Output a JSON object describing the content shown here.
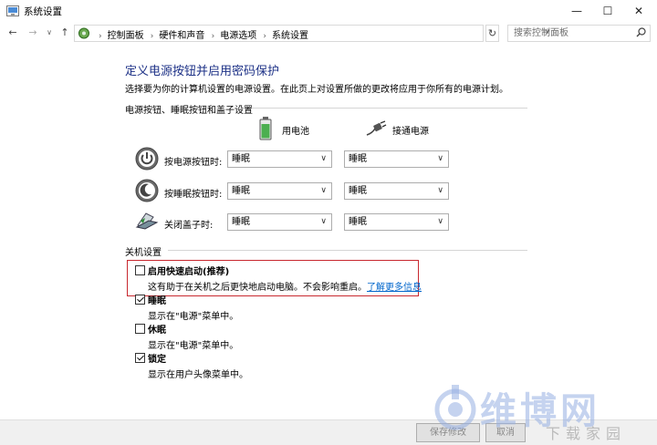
{
  "window": {
    "title": "系统设置",
    "minimize": "—",
    "maximize": "☐",
    "close": "✕"
  },
  "nav": {
    "back": "←",
    "forward": "→",
    "dropdown": "∨",
    "up": "↑",
    "breadcrumbs": [
      "控制面板",
      "硬件和声音",
      "电源选项",
      "系统设置"
    ],
    "refresh": "↻",
    "search_placeholder": "搜索控制面板"
  },
  "main": {
    "title": "定义电源按钮并启用密码保护",
    "description": "选择要为你的计算机设置的电源设置。在此页上对设置所做的更改将应用于你所有的电源计划。",
    "power_section": {
      "heading": "电源按钮、睡眠按钮和盖子设置",
      "columns": [
        "用电池",
        "接通电源"
      ],
      "rows": [
        {
          "label": "按电源按钮时:",
          "battery": "睡眠",
          "plugged": "睡眠",
          "icon": "power-button-icon"
        },
        {
          "label": "按睡眠按钮时:",
          "battery": "睡眠",
          "plugged": "睡眠",
          "icon": "sleep-button-icon"
        },
        {
          "label": "关闭盖子时:",
          "battery": "睡眠",
          "plugged": "睡眠",
          "icon": "laptop-lid-icon"
        }
      ]
    },
    "shutdown_section": {
      "heading": "关机设置",
      "items": [
        {
          "label": "启用快速启动(推荐)",
          "desc": "这有助于在关机之后更快地启动电脑。不会影响重启。",
          "link": "了解更多信息",
          "checked": false
        },
        {
          "label": "睡眠",
          "desc": "显示在\"电源\"菜单中。",
          "checked": true
        },
        {
          "label": "休眠",
          "desc": "显示在\"电源\"菜单中。",
          "checked": false
        },
        {
          "label": "锁定",
          "desc": "显示在用户头像菜单中。",
          "checked": true
        }
      ]
    }
  },
  "footer": {
    "save": "保存修改",
    "cancel": "取消"
  },
  "watermark": {
    "text": "维博网",
    "sub": "下载家园"
  },
  "colors": {
    "title_blue": "#1e3287",
    "highlight_red": "#c8282f",
    "link_blue": "#0066cc"
  }
}
